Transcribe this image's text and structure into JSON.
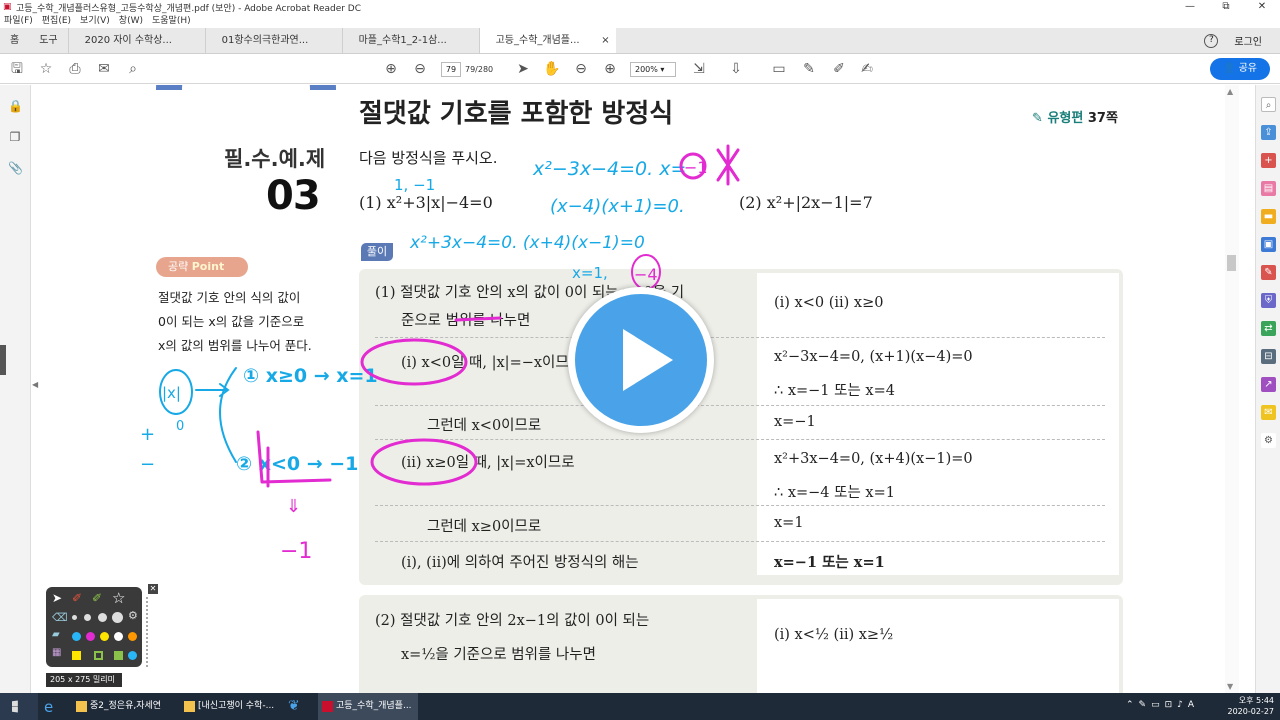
{
  "window": {
    "title": "고등_수학_개념플러스유형_고등수학상_개념편.pdf (보안) - Adobe Acrobat Reader DC",
    "controls": [
      "—",
      "⧉",
      "✕"
    ]
  },
  "menu": [
    "파일(F)",
    "편집(E)",
    "보기(V)",
    "창(W)",
    "도움말(H)"
  ],
  "tabs": {
    "home": "홈",
    "tools": "도구",
    "docs": [
      {
        "label": "2020 자이 수학상..."
      },
      {
        "label": "01항수의극한과연..."
      },
      {
        "label": "마플_수학1_2-1삼..."
      },
      {
        "label": "고등_수학_개념플..."
      }
    ],
    "close": "×",
    "help": "?",
    "login": "로그인"
  },
  "toolbar": {
    "page_current": "79",
    "page_total": "79/280",
    "zoom": "200%",
    "share": "공유"
  },
  "doc": {
    "label_yeje": "필.수.예.제",
    "label_num": "03",
    "point_a": "공략",
    "point_b": "Point",
    "tip_lines": [
      "절댓값 기호 안의 식의 값이",
      "0이 되는 x의 값을 기준으로",
      "x의 값의 범위를 나누어 푼다."
    ],
    "heading": "절댓값 기호를 포함한 방정식",
    "ref_a": "유형편",
    "ref_b": "37쪽",
    "prompt": "다음 방정식을 푸시오.",
    "eq1": "(1) x²+3|x|−4=0",
    "eq2": "(2) x²+|2x−1|=7",
    "pool": "풀이",
    "sol1": {
      "intro_1": "(1) 절댓값 기호 안의 x의 값이 0이 되는 x=0을 기",
      "intro_2": "준으로 범위를 나누면",
      "ranges": "(ⅰ) x<0      (ⅱ) x≥0",
      "case1_left": "(ⅰ) x<0일 때, |x|=−x이므로",
      "case1_r1": "x²−3x−4=0, (x+1)(x−4)=0",
      "case1_r2": "∴ x=−1 또는 x=4",
      "case1_cond": "그런데 x<0이므로",
      "case1_ans": "x=−1",
      "case2_left": "(ⅱ) x≥0일 때, |x|=x이므로",
      "case2_r1": "x²+3x−4=0, (x+4)(x−1)=0",
      "case2_r2": "∴ x=−4 또는 x=1",
      "case2_cond": "그런데 x≥0이므로",
      "case2_ans": "x=1",
      "conclusion": "(ⅰ), (ⅱ)에 의하여 주어진 방정식의 해는",
      "final": "x=−1 또는 x=1"
    },
    "sol2": {
      "intro_1": "(2) 절댓값 기호 안의 2x−1의 값이 0이 되는",
      "intro_2": "x=½을 기준으로 범위를 나누면",
      "ranges": "(ⅰ) x<½      (ⅱ) x≥½"
    }
  },
  "handwriting": {
    "top_eq": "x²−3x−4=0.  x=",
    "circled": "−1",
    "near_eq1": "1, −1",
    "factored1": "(x−4)(x+1)=0.",
    "line2": "x²+3x−4=0.  (x+4)(x−1)=0",
    "roots2": "x=1,",
    "circled2": "−4",
    "abs_note": "|x|",
    "branch1": "① x≥0  → x=1",
    "branch2": "② x<0  → −1",
    "plus": "+",
    "minus": "−",
    "zero": "0",
    "arrow_down": "⇓",
    "minus_one": "−1"
  },
  "pen_palette": {
    "size_label": "205 x 275 밀리미터"
  },
  "taskbar": {
    "items": [
      {
        "label": "중2_정은유,자세연"
      },
      {
        "label": "[내신고챙이 수학-..."
      },
      {
        "label": "고등_수학_개념플..."
      }
    ],
    "time": "오후 5:44",
    "date": "2020-02-27"
  },
  "colors": {
    "accent": "#1473e6",
    "ink_blue": "#17a9e6",
    "ink_magenta": "#e22bd0",
    "band": "#5b7fc4"
  }
}
